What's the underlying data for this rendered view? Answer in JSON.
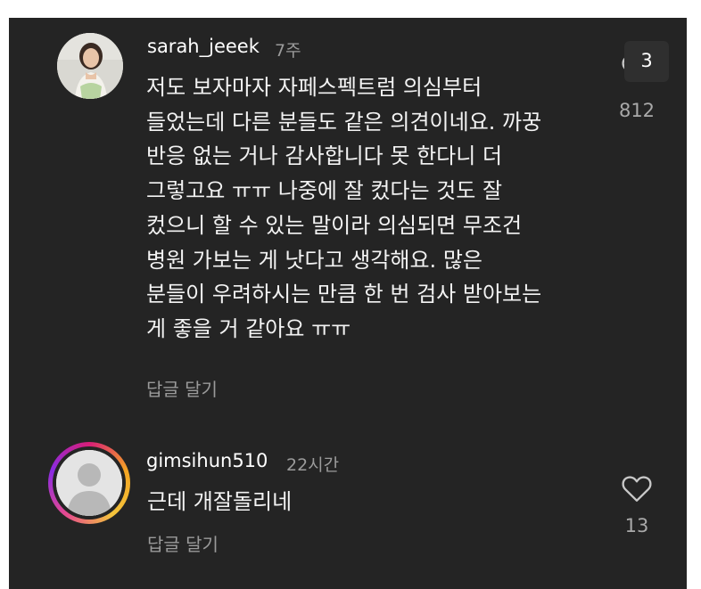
{
  "comments": [
    {
      "username": "sarah_jeeek",
      "time": "7주",
      "lines": [
        "저도 보자마자 자페스펙트럼 의심부터",
        "들었는데 다른 분들도 같은 의견이네요. 까꿍",
        "반응 없는 거나 감사합니다 못 한다니 더",
        "그렇고요 ㅠㅠ 나중에 잘 컸다는 것도 잘",
        "컸으니 할 수 있는 말이라 의심되면 무조건",
        "병원 가보는 게 낫다고 생각해요. 많은",
        "분들이 우려하시는 만큼 한 번 검사 받아보는",
        "게 좋을 거 같아요 ㅠㅠ"
      ],
      "reply_label": "답글 달기",
      "like_count": "812",
      "notification_count": "3",
      "heart_icon": "heart-outline-icon",
      "avatar_icon": "profile-photo"
    },
    {
      "username": "gimsihun510",
      "time": "22시간",
      "text": "근데 개잘돌리네",
      "reply_label": "답글 달기",
      "like_count": "13",
      "heart_icon": "heart-outline-icon",
      "avatar_icon": "default-avatar-icon",
      "story_ring_colors": [
        "#d81e78",
        "#f5a623",
        "#f3c43c",
        "#8a2be2"
      ]
    }
  ],
  "colors": {
    "background": "#242424",
    "text": "#f3f3f3",
    "muted": "#9b9b9b"
  }
}
